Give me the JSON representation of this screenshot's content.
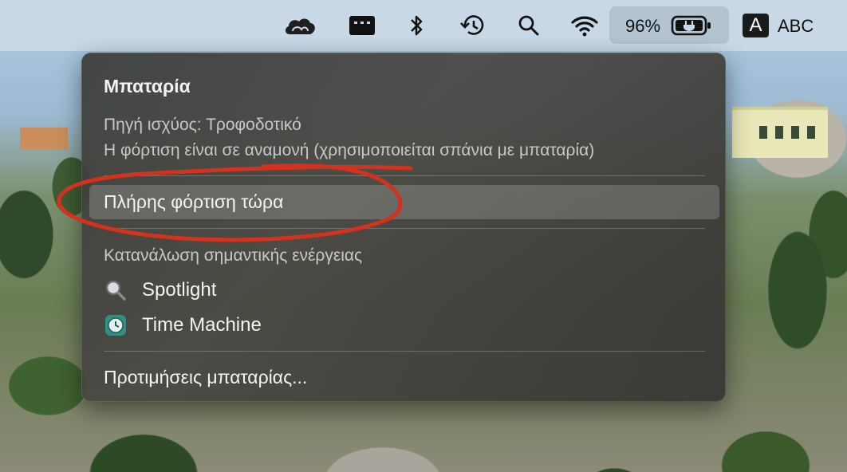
{
  "menubar": {
    "icons": [
      "creative-cloud-icon",
      "display-icon",
      "bluetooth-icon",
      "time-machine-icon",
      "spotlight-search-icon",
      "wifi-icon",
      "battery-charging-icon"
    ],
    "battery_percent": "96%",
    "input_source_letter": "A",
    "input_source_label": "ABC"
  },
  "battery_menu": {
    "title": "Μπαταρία",
    "power_source": "Πηγή ισχύος: Τροφοδοτικό",
    "charging_status": "Η φόρτιση είναι σε αναμονή (χρησιμοποιείται σπάνια με μπαταρία)",
    "charge_now_label": "Πλήρης φόρτιση τώρα",
    "energy_section_label": "Κατανάλωση σημαντικής ενέργειας",
    "apps": [
      {
        "name": "Spotlight",
        "icon": "spotlight-icon"
      },
      {
        "name": "Time Machine",
        "icon": "time-machine-icon"
      }
    ],
    "preferences_label": "Προτιμήσεις μπαταρίας..."
  },
  "colors": {
    "annotation_stroke": "#d2321e",
    "menubar_bg": "#c8d8e6"
  }
}
